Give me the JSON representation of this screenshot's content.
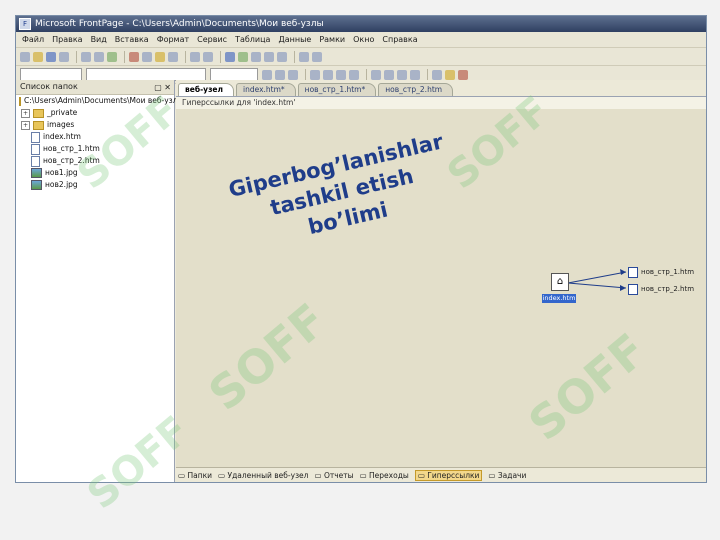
{
  "window": {
    "title": "Microsoft FrontPage - C:\\Users\\Admin\\Documents\\Мои веб-узлы"
  },
  "menu": [
    "Файл",
    "Правка",
    "Вид",
    "Вставка",
    "Формат",
    "Сервис",
    "Таблица",
    "Данные",
    "Рамки",
    "Окно",
    "Справка"
  ],
  "folder_list": {
    "title": "Список папок",
    "root": "C:\\Users\\Admin\\Documents\\Мои веб-узлы",
    "items": [
      {
        "name": "_private",
        "type": "folder"
      },
      {
        "name": "images",
        "type": "folder"
      },
      {
        "name": "index.htm",
        "type": "page"
      },
      {
        "name": "нов_стр_1.htm",
        "type": "page"
      },
      {
        "name": "нов_стр_2.htm",
        "type": "page"
      },
      {
        "name": "нов1.jpg",
        "type": "image"
      },
      {
        "name": "нов2.jpg",
        "type": "image"
      }
    ]
  },
  "tabs": [
    {
      "label": "веб-узел",
      "active": true
    },
    {
      "label": "index.htm*",
      "active": false
    },
    {
      "label": "нов_стр_1.htm*",
      "active": false
    },
    {
      "label": "нов_стр_2.htm",
      "active": false
    }
  ],
  "hyperlinks_path": "Гиперссылки для 'index.htm'",
  "caption": {
    "line1": "Giperbog’lanishlar",
    "line2": "tashkil etish",
    "line3": "bo’limi"
  },
  "diagram": {
    "center": "index.htm",
    "links": [
      "нов_стр_1.htm",
      "нов_стр_2.htm"
    ]
  },
  "views": [
    {
      "label": "Папки",
      "active": false
    },
    {
      "label": "Удаленный веб-узел",
      "active": false
    },
    {
      "label": "Отчеты",
      "active": false
    },
    {
      "label": "Переходы",
      "active": false
    },
    {
      "label": "Гиперссылки",
      "active": true
    },
    {
      "label": "Задачи",
      "active": false
    }
  ],
  "watermark": "SOFF",
  "colors": {
    "caption": "#1f3d8a",
    "selection": "#3366cc",
    "active_view": "#f3d88b"
  }
}
